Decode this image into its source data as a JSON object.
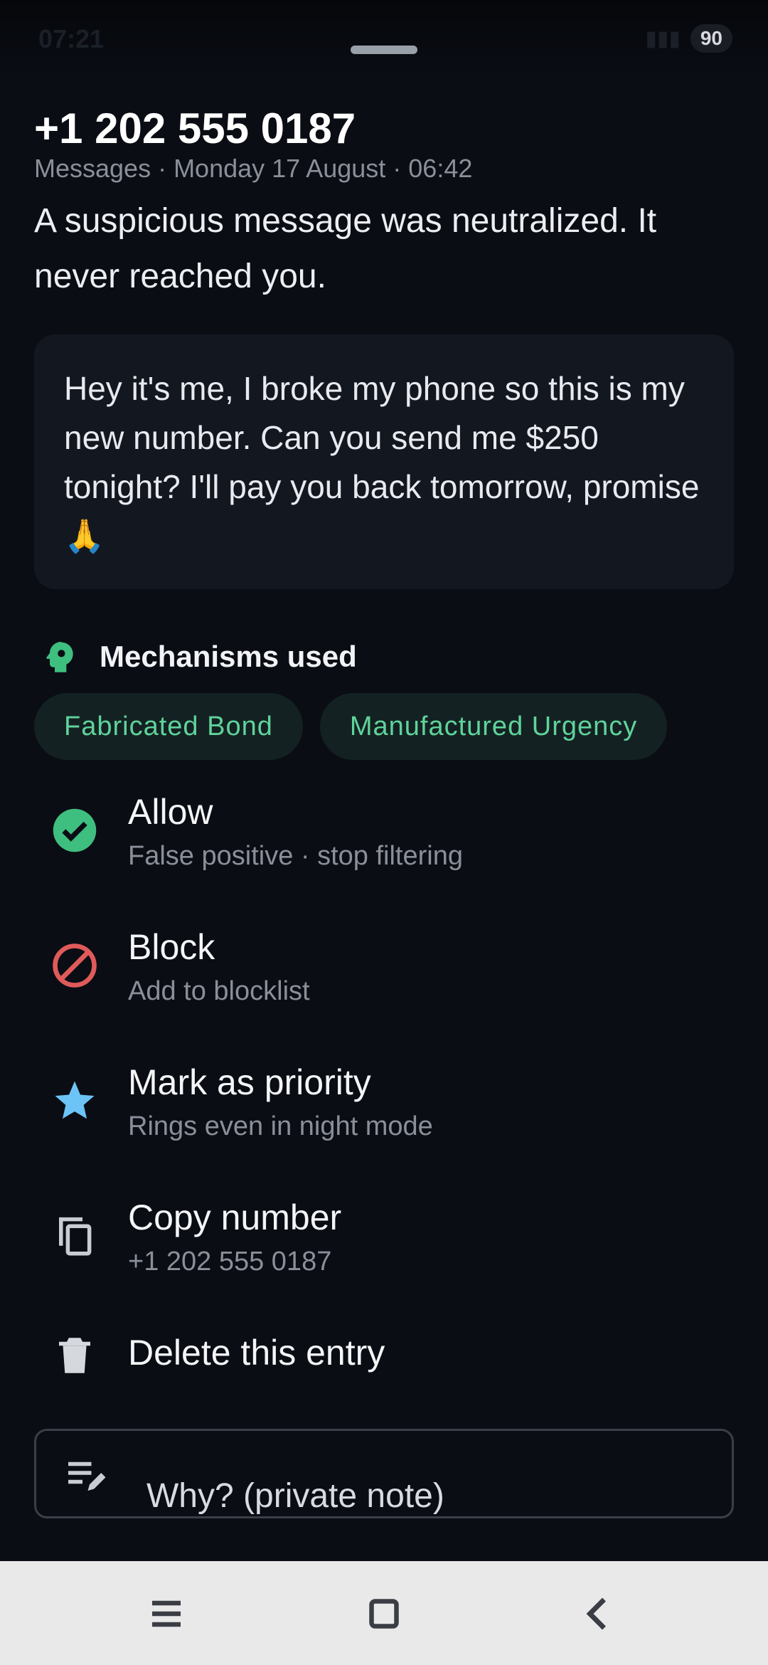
{
  "status_bar": {
    "time": "07:21",
    "battery": "90"
  },
  "header": {
    "phone_number": "+1 202 555 0187",
    "meta": "Messages · Monday 17 August · 06:42",
    "summary": "A suspicious message was neutralized. It never reached you."
  },
  "message": {
    "text": "Hey it's me, I broke my phone so this is my new number. Can you send me $250 tonight? I'll pay you back tomorrow, promise 🙏"
  },
  "mechanisms": {
    "title": "Mechanisms used",
    "chips": [
      "Fabricated Bond",
      "Manufactured Urgency"
    ]
  },
  "actions": [
    {
      "label": "Allow",
      "sub": "False positive · stop filtering",
      "icon": "check-circle-icon"
    },
    {
      "label": "Block",
      "sub": "Add to blocklist",
      "icon": "block-icon"
    },
    {
      "label": "Mark as priority",
      "sub": "Rings even in night mode",
      "icon": "star-icon"
    },
    {
      "label": "Copy number",
      "sub": "+1 202 555 0187",
      "icon": "copy-icon"
    },
    {
      "label": "Delete this entry",
      "icon": "trash-icon"
    }
  ],
  "note": {
    "placeholder": "Why? (private note)",
    "icon": "edit-note-icon"
  },
  "colors": {
    "accent_green": "#3fbf7f",
    "chip_text": "#5fd39b",
    "block_red": "#e05a5a",
    "star_blue": "#6cc3f5",
    "background": "#0a0d14"
  }
}
